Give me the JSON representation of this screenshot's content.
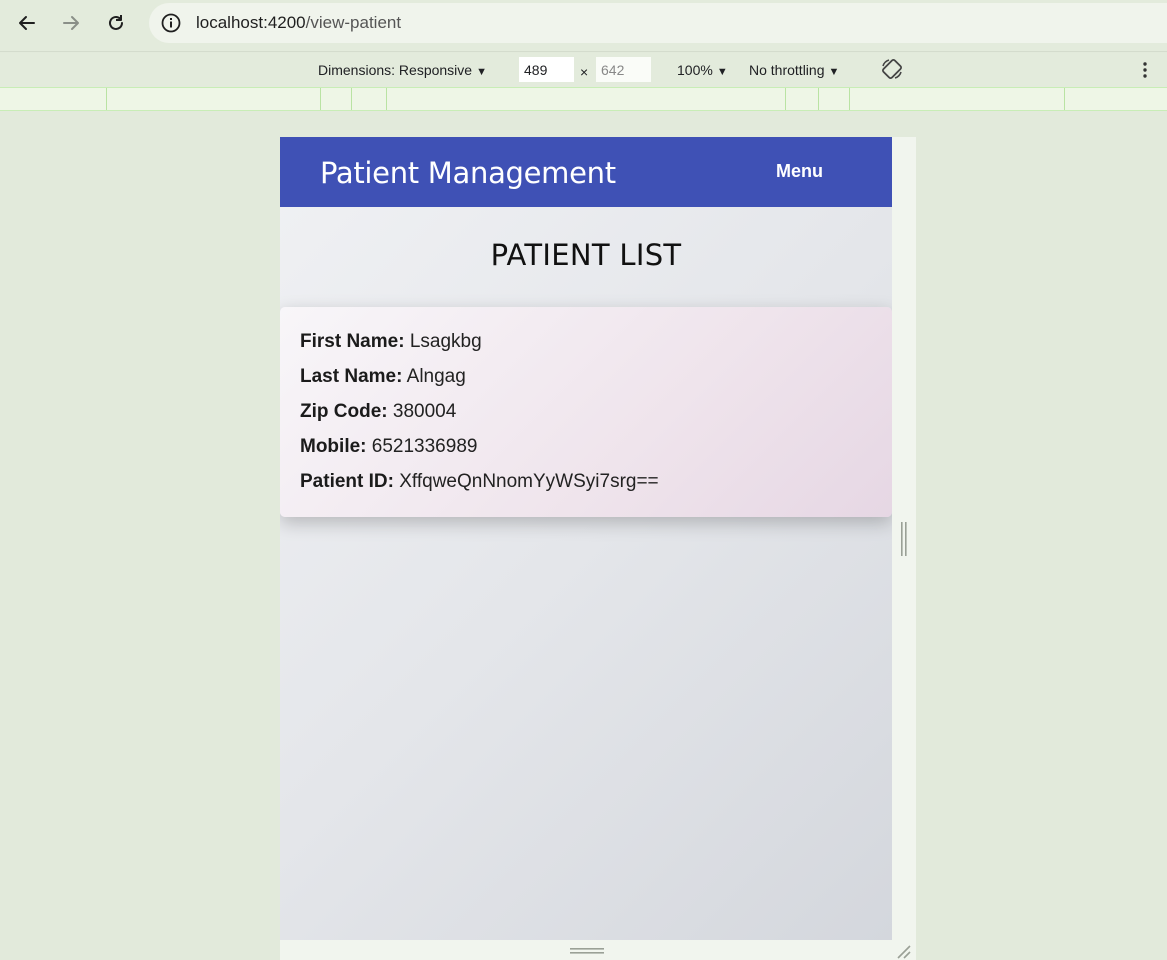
{
  "browser": {
    "url_host": "localhost:4200",
    "url_path": "/view-patient",
    "icons": {
      "back": "arrow-left-icon",
      "forward": "arrow-right-icon",
      "reload": "reload-icon",
      "site_info": "info-icon"
    }
  },
  "devtools": {
    "dimensions_label": "Dimensions: Responsive",
    "width": "489",
    "times": "×",
    "height": "642",
    "zoom": "100%",
    "throttling": "No throttling",
    "caret": "▼"
  },
  "app": {
    "title": "Patient Management",
    "menu_label": "Menu",
    "heading": "PATIENT LIST",
    "header_color": "#3f51b5",
    "patient": {
      "first_name_label": "First Name:",
      "first_name": "Lsagkbg",
      "last_name_label": "Last Name:",
      "last_name": "Alngag",
      "zip_label": "Zip Code:",
      "zip": "380004",
      "mobile_label": "Mobile:",
      "mobile": "6521336989",
      "id_label": "Patient ID:",
      "id": "XffqweQnNnomYyWSyi7srg=="
    }
  }
}
